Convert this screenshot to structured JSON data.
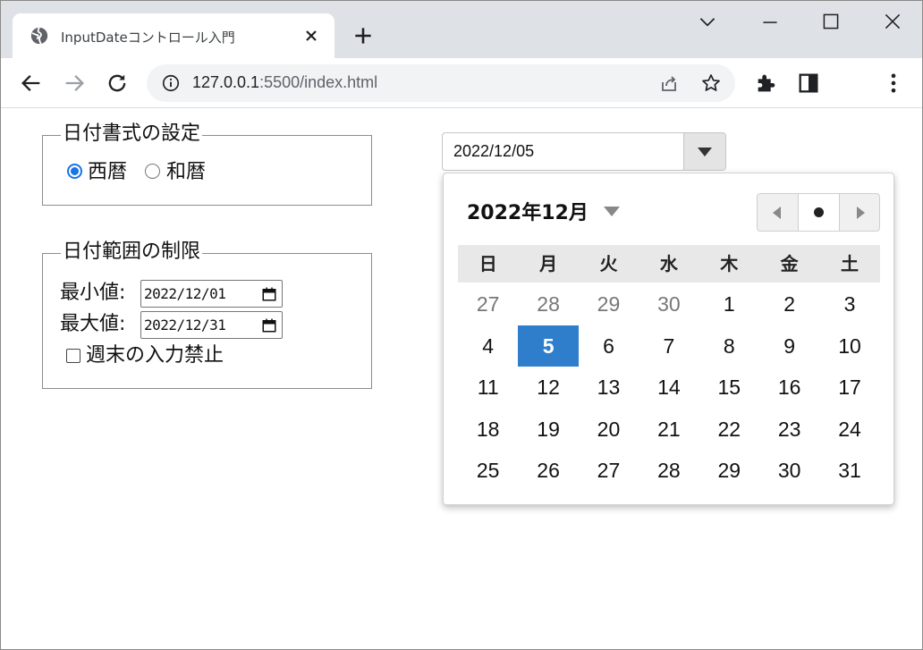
{
  "browser": {
    "tab_title": "InputDateコントロール入門",
    "url_host": "127.0.0.1",
    "url_rest": ":5500/index.html"
  },
  "format_settings": {
    "legend": "日付書式の設定",
    "options": [
      {
        "label": "西暦",
        "selected": true
      },
      {
        "label": "和暦",
        "selected": false
      }
    ]
  },
  "range_settings": {
    "legend": "日付範囲の制限",
    "min_label": "最小値:",
    "min_value": "2022/12/01",
    "max_label": "最大値:",
    "max_value": "2022/12/31",
    "weekend_label": "週末の入力禁止",
    "weekend_checked": false
  },
  "date_picker": {
    "value": "2022/12/05",
    "month_title": "2022年12月",
    "weekdays": [
      "日",
      "月",
      "火",
      "水",
      "木",
      "金",
      "土"
    ],
    "weeks": [
      [
        "27",
        "28",
        "29",
        "30",
        "1",
        "2",
        "3"
      ],
      [
        "4",
        "5",
        "6",
        "7",
        "8",
        "9",
        "10"
      ],
      [
        "11",
        "12",
        "13",
        "14",
        "15",
        "16",
        "17"
      ],
      [
        "18",
        "19",
        "20",
        "21",
        "22",
        "23",
        "24"
      ],
      [
        "25",
        "26",
        "27",
        "28",
        "29",
        "30",
        "31"
      ]
    ],
    "other_month_days": 4,
    "selected_day": "5",
    "accent_color": "#2f7ecb"
  }
}
